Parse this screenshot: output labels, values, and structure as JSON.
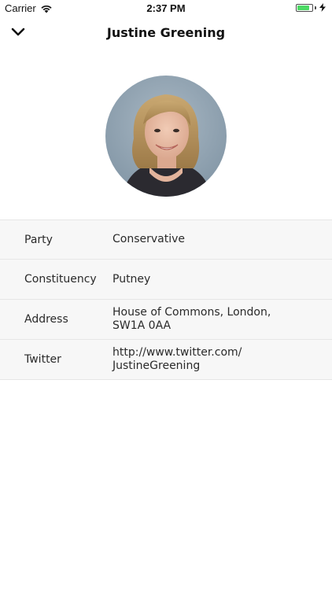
{
  "status_bar": {
    "carrier": "Carrier",
    "time": "2:37 PM",
    "battery_level": 0.85,
    "battery_color": "#4cd964"
  },
  "nav": {
    "title": "Justine Greening",
    "back_icon": "chevron-down-icon"
  },
  "profile": {
    "avatar_icon": "portrait-photo"
  },
  "details": [
    {
      "label": "Party",
      "value": "Conservative"
    },
    {
      "label": "Constituency",
      "value": "Putney"
    },
    {
      "label": "Address",
      "value": "House of Commons, London, SW1A 0AA"
    },
    {
      "label": "Twitter",
      "value": "http://www.twitter.com/ JustineGreening"
    }
  ]
}
